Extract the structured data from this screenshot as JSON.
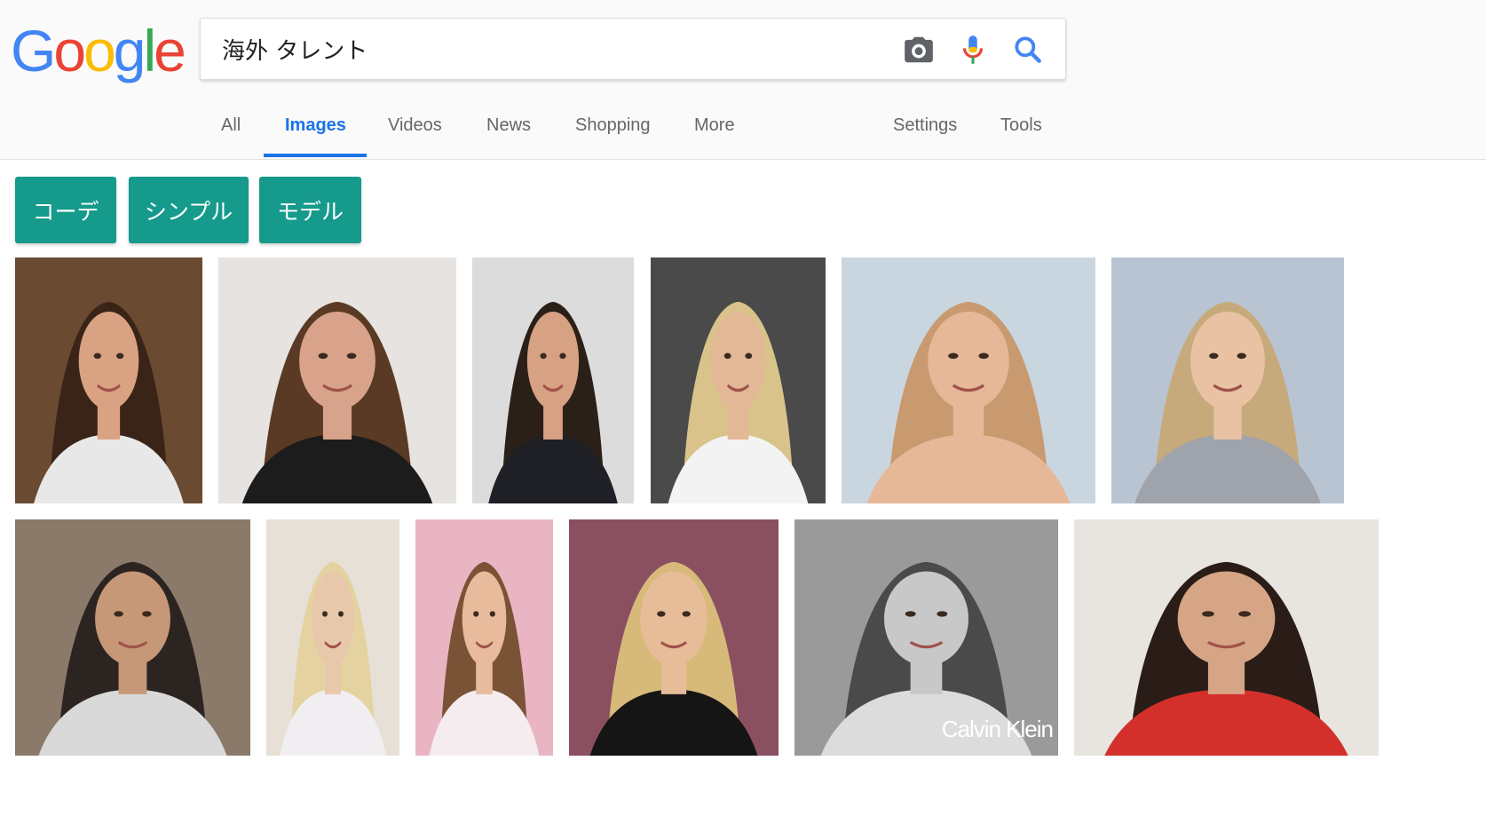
{
  "logo": {
    "letters": [
      "G",
      "o",
      "o",
      "g",
      "l",
      "e"
    ],
    "colors": [
      "#4285F4",
      "#EA4335",
      "#FBBC05",
      "#4285F4",
      "#34A853",
      "#EA4335"
    ]
  },
  "search": {
    "query": "海外 タレント",
    "placeholder": ""
  },
  "tabs": [
    {
      "label": "All"
    },
    {
      "label": "Images",
      "active": true
    },
    {
      "label": "Videos"
    },
    {
      "label": "News"
    },
    {
      "label": "Shopping"
    },
    {
      "label": "More"
    },
    {
      "label": "Settings"
    },
    {
      "label": "Tools"
    }
  ],
  "chips": [
    {
      "label": "コーデ"
    },
    {
      "label": "シンプル"
    },
    {
      "label": "モデル"
    }
  ],
  "results": [
    {
      "bg": "#6b4a32",
      "skin": "#d9a383",
      "hair": "#3a2418",
      "shirt": "#e8e8e8"
    },
    {
      "bg": "#e6e3e0",
      "skin": "#d8a38a",
      "hair": "#5a3a24",
      "shirt": "#1c1c1c"
    },
    {
      "bg": "#dcdcdc",
      "skin": "#d7a184",
      "hair": "#2b2018",
      "shirt": "#1f1f26"
    },
    {
      "bg": "#4a4a4a",
      "skin": "#e2b896",
      "hair": "#d9c38a",
      "shirt": "#f3f3f3"
    },
    {
      "bg": "#c9d6e0",
      "skin": "#e6b898",
      "hair": "#c99a70",
      "shirt": "#e6b898"
    },
    {
      "bg": "#b9c4d2",
      "skin": "#e9c2a4",
      "hair": "#c7aa7c",
      "shirt": "#9fa3ab"
    },
    {
      "bg": "#8b7a6a",
      "skin": "#c69877",
      "hair": "#2c2420",
      "shirt": "#d9d9d9"
    },
    {
      "bg": "#e6e0d6",
      "skin": "#e8c8aa",
      "hair": "#e4d2a0",
      "shirt": "#f0eef0"
    },
    {
      "bg": "#e9b5c3",
      "skin": "#e7bb9c",
      "hair": "#7a5236",
      "shirt": "#f4ecee"
    },
    {
      "bg": "#8a5060",
      "skin": "#e7bc98",
      "hair": "#d7ba7a",
      "shirt": "#151515"
    },
    {
      "bg": "#9a9a9a",
      "skin": "#c8c8c8",
      "hair": "#4a4a4a",
      "shirt": "#dcdcdc",
      "text": "Calvin Klein"
    },
    {
      "bg": "#e8e4e0",
      "skin": "#d6a585",
      "hair": "#2a1c16",
      "shirt": "#d3302c"
    }
  ]
}
